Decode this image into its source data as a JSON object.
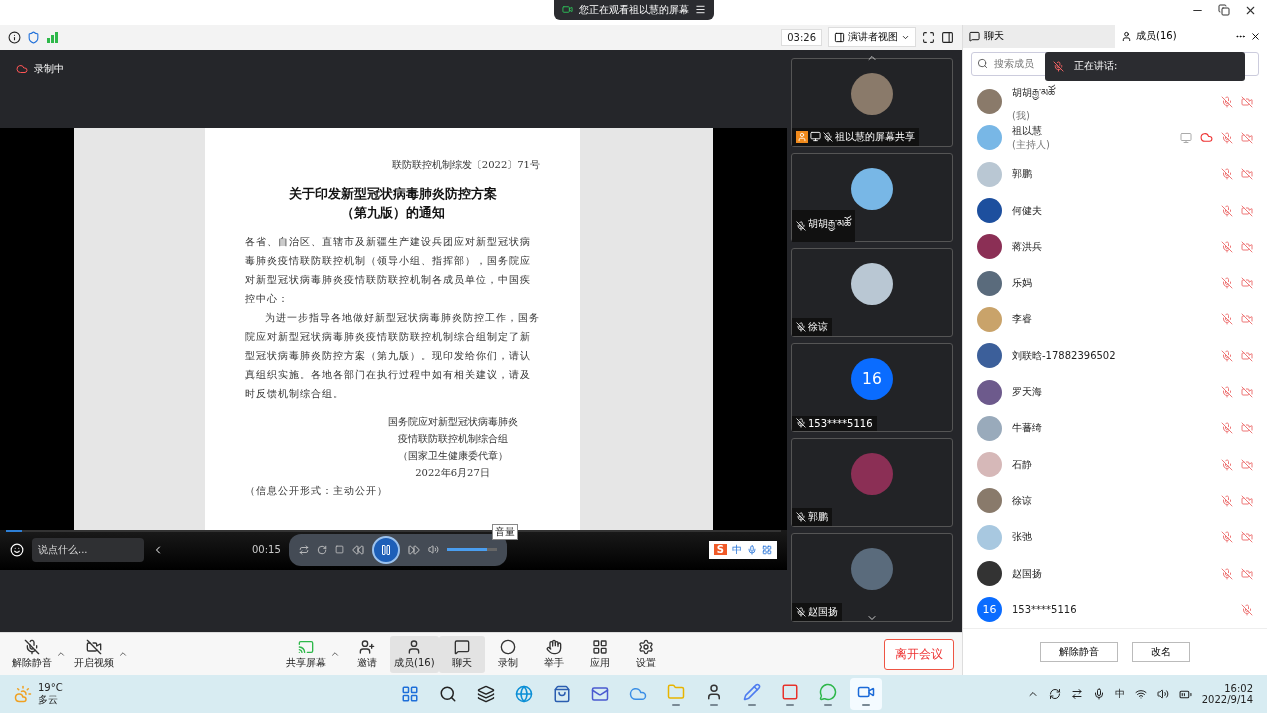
{
  "titlebar": {
    "banner": "您正在观看祖以慧的屏幕"
  },
  "toolbar": {
    "timer": "03:26",
    "view": "演讲者视图"
  },
  "side_tabs": [
    {
      "label": "聊天",
      "kind": "chat",
      "selected": false
    },
    {
      "label": "成员(16)",
      "kind": "members",
      "selected": true
    }
  ],
  "recording": "录制中",
  "document": {
    "ref": "联防联控机制综发〔2022〕71号",
    "title": [
      "关于印发新型冠状病毒肺炎防控方案",
      "（第九版）的通知"
    ],
    "salutation": "各省、自治区、直辖市及新疆生产建设兵团应对新型冠状病毒肺炎疫情联防联控机制（领导小组、指挥部），国务院应对新型冠状病毒肺炎疫情联防联控机制各成员单位，中国疾控中心：",
    "body": "为进一步指导各地做好新型冠状病毒肺炎防控工作，国务院应对新型冠状病毒肺炎疫情联防联控机制综合组制定了新型冠状病毒肺炎防控方案（第九版）。现印发给你们，请认真组织实施。各地各部门在执行过程中如有相关建议，请及时反馈机制综合组。",
    "signature": [
      "国务院应对新型冠状病毒肺炎",
      "疫情联防联控机制综合组",
      "（国家卫生健康委代章）",
      "2022年6月27日"
    ],
    "note": "（信息公开形式：主动公开）"
  },
  "player": {
    "time": "00:15",
    "progress": {
      "level": 0.02
    },
    "volume": {
      "level": 0.8
    },
    "tooltip": "音量"
  },
  "ime": {
    "logo": "S",
    "label": "中"
  },
  "chat_input": {
    "placeholder": "说点什么..."
  },
  "thumbnails": [
    {
      "name": "祖以慧的屏幕共享",
      "kind": "photo",
      "host": true
    },
    {
      "name": "胡胡རྒྱ་མཚོ",
      "kind": "photo",
      "host": false
    },
    {
      "name": "徐谅",
      "kind": "photo",
      "host": false
    },
    {
      "name": "153****5116",
      "kind": "number",
      "initial": "16",
      "host": false
    },
    {
      "name": "郭鹏",
      "kind": "photo",
      "host": false
    },
    {
      "name": "赵国扬",
      "kind": "photo",
      "host": false
    }
  ],
  "search": {
    "placeholder": "搜索成员"
  },
  "speaking": {
    "label": "正在讲话:"
  },
  "members": [
    {
      "name": "胡胡རྒྱ་མཚོ",
      "role": "(我)",
      "kind": "photo",
      "sharing": false,
      "recording": false,
      "camera_off": true
    },
    {
      "name": "祖以慧",
      "role": "(主持人)",
      "kind": "photo",
      "sharing": true,
      "recording": true,
      "camera_off": true
    },
    {
      "name": "郭鹏",
      "kind": "photo",
      "sharing": false,
      "recording": false,
      "camera_off": true
    },
    {
      "name": "何健夫",
      "kind": "photo",
      "sharing": false,
      "recording": false,
      "camera_off": true
    },
    {
      "name": "蒋洪兵",
      "kind": "photo",
      "sharing": false,
      "recording": false,
      "camera_off": true
    },
    {
      "name": "乐妈",
      "kind": "photo",
      "sharing": false,
      "recording": false,
      "camera_off": true
    },
    {
      "name": "李睿",
      "kind": "photo",
      "sharing": false,
      "recording": false,
      "camera_off": true
    },
    {
      "name": "刘联晗-17882396502",
      "kind": "photo",
      "sharing": false,
      "recording": false,
      "camera_off": true
    },
    {
      "name": "罗天海",
      "kind": "photo",
      "sharing": false,
      "recording": false,
      "camera_off": true
    },
    {
      "name": "牛蕃绮",
      "kind": "photo",
      "sharing": false,
      "recording": false,
      "camera_off": true
    },
    {
      "name": "石静",
      "kind": "photo",
      "sharing": false,
      "recording": false,
      "camera_off": true
    },
    {
      "name": "徐谅",
      "kind": "photo",
      "sharing": false,
      "recording": false,
      "camera_off": true
    },
    {
      "name": "张弛",
      "kind": "photo",
      "sharing": false,
      "recording": false,
      "camera_off": true
    },
    {
      "name": "赵国扬",
      "kind": "photo",
      "sharing": false,
      "recording": false,
      "camera_off": true
    },
    {
      "name": "153****5116",
      "kind": "number",
      "initial": "16",
      "sharing": false,
      "recording": false,
      "camera_off": false
    }
  ],
  "member_buttons": [
    "解除静音",
    "改名"
  ],
  "controls": [
    {
      "label": "解除静音",
      "kind": "mic",
      "caret": true,
      "selected": false
    },
    {
      "label": "开启视频",
      "kind": "video",
      "caret": true,
      "selected": false
    },
    {
      "label": "共享屏幕",
      "kind": "share",
      "caret": true,
      "selected": false
    },
    {
      "label": "邀请",
      "kind": "invite",
      "caret": false,
      "selected": false
    },
    {
      "label": "成员(16)",
      "kind": "members",
      "caret": false,
      "selected": true
    },
    {
      "label": "聊天",
      "kind": "chat",
      "caret": false,
      "selected": true
    },
    {
      "label": "录制",
      "kind": "record",
      "caret": false,
      "selected": false
    },
    {
      "label": "举手",
      "kind": "hand",
      "caret": false,
      "selected": false
    },
    {
      "label": "应用",
      "kind": "apps",
      "caret": false,
      "selected": false
    },
    {
      "label": "设置",
      "kind": "settings",
      "caret": false,
      "selected": false
    }
  ],
  "leave_button": "离开会议",
  "taskbar": {
    "temperature": "19°C",
    "weather": "多云",
    "apps": [
      {
        "kind": "start",
        "running": false,
        "selected": false
      },
      {
        "kind": "search",
        "running": false,
        "selected": false
      },
      {
        "kind": "taskview",
        "running": false,
        "selected": false
      },
      {
        "kind": "browser",
        "running": false,
        "selected": false
      },
      {
        "kind": "store",
        "running": false,
        "selected": false
      },
      {
        "kind": "mail",
        "running": false,
        "selected": false
      },
      {
        "kind": "cloud",
        "running": false,
        "selected": false
      },
      {
        "kind": "folder",
        "running": true,
        "selected": false
      },
      {
        "kind": "avatar",
        "running": true,
        "selected": false
      },
      {
        "kind": "pen",
        "running": true,
        "selected": false
      },
      {
        "kind": "office",
        "running": true,
        "selected": false
      },
      {
        "kind": "chat",
        "running": true,
        "selected": false
      },
      {
        "kind": "meeting",
        "running": true,
        "selected": true
      }
    ],
    "ime": "中",
    "time": "16:02",
    "date": "2022/9/14"
  }
}
